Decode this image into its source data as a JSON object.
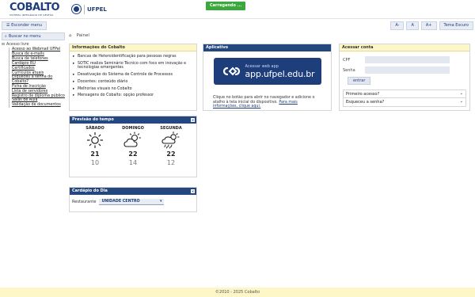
{
  "header": {
    "logo_text": "COBALTO",
    "logo_subtitle": "SISTEMA INTEGRADO DE GESTÃO",
    "university": "UFPEL",
    "loading_label": "Carregando ..."
  },
  "toolbar": {
    "menu_toggle_label": "Esconder menu",
    "font_decrease": "A-",
    "font_normal": "A",
    "font_increase": "A+",
    "dark_theme": "Tema Escuro"
  },
  "sidebar": {
    "search_placeholder": "Buscar no menu",
    "root_label": "Acesso livre",
    "items": [
      "Acesso ao Webmail UFPel",
      "Busca de e-mails",
      "Busca de telefones",
      "Cardápio RU",
      "Certificados",
      "Currículos atuais",
      "Esqueceu a senha do Cobalto?",
      "Ficha de Inscrição",
      "Lista de servidores",
      "Registro de diploma público",
      "Salas de Aula",
      "Validação de documentos"
    ]
  },
  "breadcrumb": {
    "current": "Painel"
  },
  "news": {
    "title": "Informações do Cobalto",
    "items": [
      "Bancas de Heteroidentificação para pessoas negras",
      "SOTIC realiza Seminário Técnico com foco em inovação e tecnologias emergentes",
      "Desativação do Sistema de Controle de Processos",
      "Docentes: conteúdo diário",
      "Melhorias visuais no Cobalto",
      "Mensagens do Cobalto: opção professor"
    ]
  },
  "weather": {
    "title": "Previsão do tempo",
    "close": "×",
    "days": [
      {
        "day": "SÁBADO",
        "icon": "sun-icon",
        "max": "21",
        "min": "10"
      },
      {
        "day": "DOMINGO",
        "icon": "partly-cloudy-icon",
        "max": "22",
        "min": "14"
      },
      {
        "day": "SEGUNDA",
        "icon": "rain-cloud-icon",
        "max": "22",
        "min": "12"
      }
    ]
  },
  "menu_day": {
    "title": "Cardápio do Dia",
    "close": "×",
    "restaurant_label": "Restaurante",
    "restaurant_value": "UNIDADE CENTRO"
  },
  "app": {
    "title": "Aplicativo",
    "button_small": "Acessar web app",
    "button_big": "app.ufpel.edu.br",
    "note_text": "Clique no botão para abrir no navegador e adicione o atalho à tela inicial do dispositivo. ",
    "note_link": "Para mais informações, clique aqui."
  },
  "login": {
    "title": "Acessar conta",
    "cpf_label": "CPF",
    "password_label": "Senha",
    "submit_label": "entrar",
    "first_access": "Primeiro acesso?",
    "forgot_password": "Esqueceu a senha?"
  },
  "footer": {
    "text": "©2010 - 2025 Cobalto"
  },
  "colors": {
    "brand_blue": "#1e3d7b",
    "panel_blue": "#24477f",
    "panel_yellow": "#fdf6c6",
    "loading_green": "#3aa83a"
  }
}
